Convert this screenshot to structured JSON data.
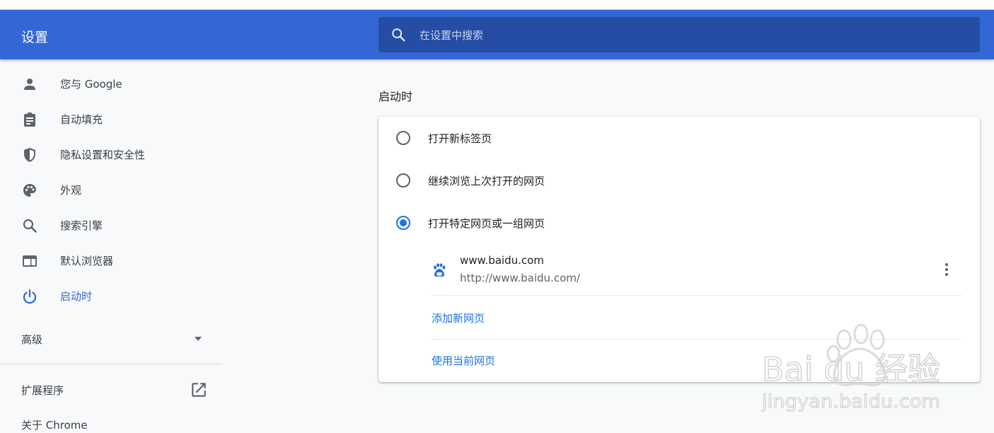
{
  "header": {
    "title": "设置",
    "search_placeholder": "在设置中搜索"
  },
  "sidebar": {
    "items": [
      {
        "label": "您与 Google",
        "icon": "person-icon"
      },
      {
        "label": "自动填充",
        "icon": "clipboard-icon"
      },
      {
        "label": "隐私设置和安全性",
        "icon": "shield-icon"
      },
      {
        "label": "外观",
        "icon": "palette-icon"
      },
      {
        "label": "搜索引擎",
        "icon": "search-icon"
      },
      {
        "label": "默认浏览器",
        "icon": "browser-window-icon"
      },
      {
        "label": "启动时",
        "icon": "power-icon",
        "active": true
      }
    ],
    "advanced_label": "高级",
    "extensions_label": "扩展程序",
    "about_label": "关于 Chrome"
  },
  "startup": {
    "section_title": "启动时",
    "options": [
      {
        "label": "打开新标签页",
        "checked": false
      },
      {
        "label": "继续浏览上次打开的网页",
        "checked": false
      },
      {
        "label": "打开特定网页或一组网页",
        "checked": true
      }
    ],
    "page": {
      "name": "www.baidu.com",
      "url": "http://www.baidu.com/"
    },
    "add_page_label": "添加新网页",
    "use_current_label": "使用当前网页"
  },
  "watermark": {
    "brand": "Bai du 经验",
    "url": "jingyan.baidu.com"
  },
  "colors": {
    "header_bg": "#3367d6",
    "search_bg": "#264da4",
    "accent": "#1a73e8",
    "active_nav": "#3367d6"
  }
}
